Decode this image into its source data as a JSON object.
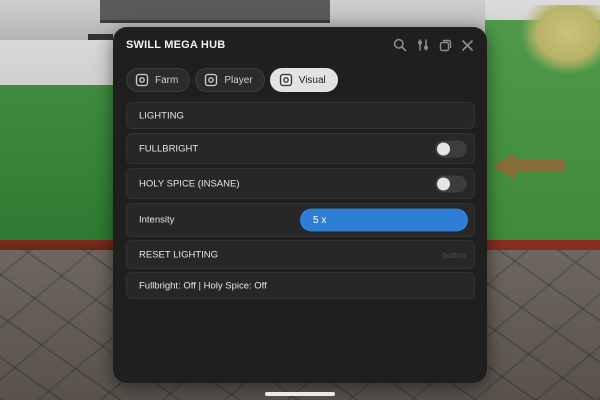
{
  "window": {
    "title": "SWILL MEGA HUB",
    "icons": [
      "search-icon",
      "sliders-icon",
      "minimize-icon",
      "close-icon"
    ]
  },
  "tabs": [
    {
      "label": "Farm",
      "icon": "tab-icon",
      "active": false
    },
    {
      "label": "Player",
      "icon": "tab-icon",
      "active": false
    },
    {
      "label": "Visual",
      "icon": "tab-icon",
      "active": true
    }
  ],
  "content": {
    "section_header": "LIGHTING",
    "fullbright": {
      "label": "FULLBRIGHT",
      "on": false
    },
    "holy_spice": {
      "label": "HOLY SPICE (INSANE)",
      "on": false
    },
    "intensity": {
      "label": "Intensity",
      "value_text": "5 x",
      "fill": 1.0
    },
    "reset": {
      "label": "RESET LIGHTING",
      "hint": "button"
    },
    "status": "Fullbright: Off | Holy Spice: Off"
  },
  "colors": {
    "panel": "#1f1f1f",
    "row": "#272727",
    "accent": "#2e7fd4",
    "active_tab": "#e2e2e2"
  }
}
